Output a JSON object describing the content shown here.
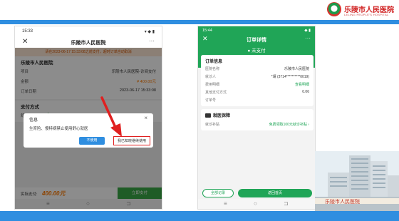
{
  "slide": {
    "hospital_name": "乐陵市人民医院",
    "hospital_name_en": "LELING PEOPLE'S HOSPITAL",
    "photo_caption": "乐陵市人民医院"
  },
  "phone1": {
    "status_time": "15:33",
    "status_icons": "▾ ◆ ▮",
    "title": "乐陵市人民医院",
    "close_icon": "✕",
    "more_icon": "···",
    "warning": "请在2023-06-17 15:33:08之前支付，超时订单自动取消",
    "section_hospital": "乐陵市人民医院",
    "rows": [
      {
        "label": "项目",
        "value": "乐陵市人民医院-诊间支付"
      },
      {
        "label": "金额",
        "value": "¥ 400.00元"
      },
      {
        "label": "订单日期",
        "value": "2023-06-17 15:33:08"
      }
    ],
    "pay_section": "支付方式",
    "pay_method": "舒心就医",
    "dialog": {
      "title": "信息",
      "message": "生育险、慢特病禁止使用舒心就医",
      "btn_no": "不使用",
      "btn_yes": "我已知晓继续使用"
    },
    "bottom": {
      "label": "实际支付:",
      "amount": "400.00元",
      "button": "立即支付"
    }
  },
  "phone2": {
    "status_time": "15:44",
    "status_icons": "◆ ▮",
    "title": "订单详情",
    "close_icon": "✕",
    "more_icon": "···",
    "status": "未支付",
    "order_card": {
      "title": "订单信息",
      "rows": [
        {
          "label": "医院名称",
          "value": "乐陵市人民医院"
        },
        {
          "label": "就诊人",
          "value": "*靖 (3714**********0019)"
        },
        {
          "label": "费用明细",
          "value": "查看明细"
        },
        {
          "label": "其他支付方式",
          "value": "0.06"
        },
        {
          "label": "订单号",
          "value": ""
        }
      ]
    },
    "guarantee_card": {
      "title": "就医保障",
      "row_label": "就诊补贴",
      "row_value": "免费领取100元就诊补贴 ›"
    },
    "btn_left": "全部记录",
    "btn_right": "返回首页"
  },
  "nav": {
    "back": "≡",
    "home": "○",
    "recent": "⊐"
  }
}
